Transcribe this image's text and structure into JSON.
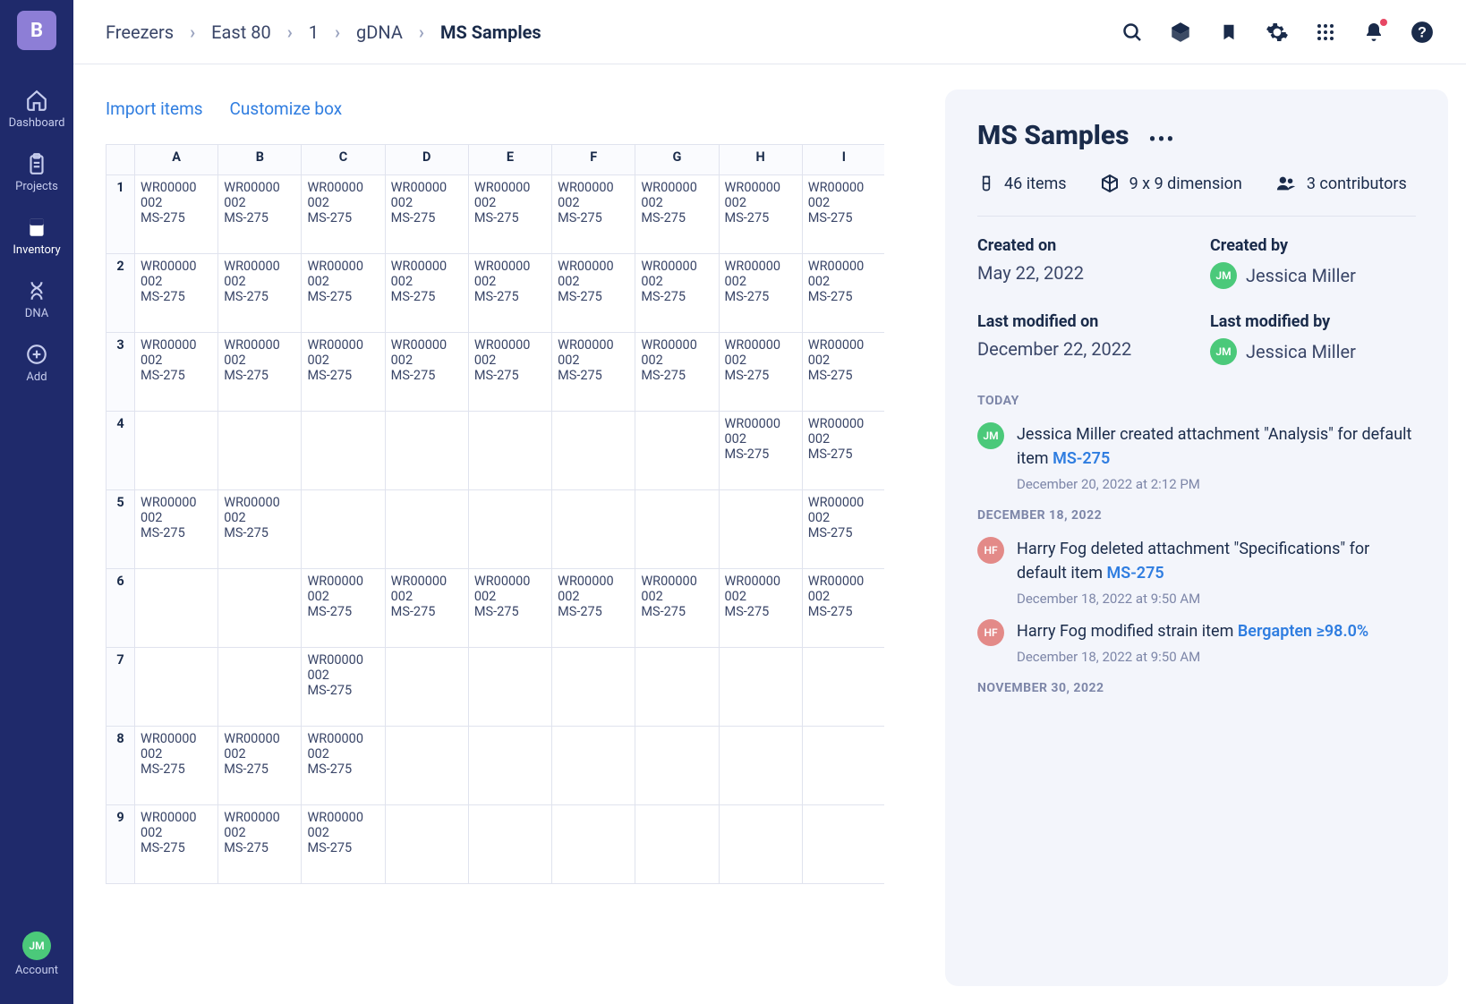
{
  "sidebar": {
    "logo_letter": "B",
    "items": [
      {
        "label": "Dashboard"
      },
      {
        "label": "Projects"
      },
      {
        "label": "Inventory"
      },
      {
        "label": "DNA"
      },
      {
        "label": "Add"
      }
    ],
    "account_label": "Account",
    "account_initials": "JM"
  },
  "breadcrumb": [
    {
      "label": "Freezers"
    },
    {
      "label": "East 80"
    },
    {
      "label": "1"
    },
    {
      "label": "gDNA"
    },
    {
      "label": "MS Samples",
      "current": true
    }
  ],
  "toolbar": {
    "import_label": "Import items",
    "customize_label": "Customize box"
  },
  "grid": {
    "columns": [
      "A",
      "B",
      "C",
      "D",
      "E",
      "F",
      "G",
      "H",
      "I"
    ],
    "cell": {
      "l1": "WR00000",
      "l2": "002",
      "l3": "MS-275"
    },
    "rows": [
      {
        "n": "1",
        "fill": [
          1,
          1,
          1,
          1,
          1,
          1,
          1,
          1,
          1
        ]
      },
      {
        "n": "2",
        "fill": [
          1,
          1,
          1,
          1,
          1,
          1,
          1,
          1,
          1
        ]
      },
      {
        "n": "3",
        "fill": [
          1,
          1,
          1,
          1,
          1,
          1,
          1,
          1,
          1
        ]
      },
      {
        "n": "4",
        "fill": [
          0,
          0,
          0,
          0,
          0,
          0,
          0,
          1,
          1
        ]
      },
      {
        "n": "5",
        "fill": [
          1,
          1,
          0,
          0,
          0,
          0,
          0,
          0,
          1
        ]
      },
      {
        "n": "6",
        "fill": [
          0,
          0,
          1,
          1,
          1,
          1,
          1,
          1,
          1
        ]
      },
      {
        "n": "7",
        "fill": [
          0,
          0,
          1,
          0,
          0,
          0,
          0,
          0,
          0
        ]
      },
      {
        "n": "8",
        "fill": [
          1,
          1,
          1,
          0,
          0,
          0,
          0,
          0,
          0
        ]
      },
      {
        "n": "9",
        "fill": [
          1,
          1,
          1,
          0,
          0,
          0,
          0,
          0,
          0
        ]
      }
    ]
  },
  "panel": {
    "title": "MS Samples",
    "stats": {
      "items_count": "46 items",
      "dimension": "9 x 9 dimension",
      "contributors": "3 contributors"
    },
    "meta": {
      "created_on_label": "Created on",
      "created_on": "May 22, 2022",
      "created_by_label": "Created by",
      "created_by": "Jessica Miller",
      "created_by_initials": "JM",
      "modified_on_label": "Last modified on",
      "modified_on": "December 22, 2022",
      "modified_by_label": "Last modified by",
      "modified_by": "Jessica Miller",
      "modified_by_initials": "JM"
    },
    "activity": {
      "today_label": "TODAY",
      "dec18_label": "DECEMBER 18, 2022",
      "nov30_label": "NOVEMBER 30, 2022",
      "items": [
        {
          "initials": "JM",
          "avatar": "jm",
          "text_before": "Jessica Miller created attachment \"Analysis\" for default item ",
          "link": "MS-275",
          "timestamp": "December 20, 2022 at 2:12 PM"
        },
        {
          "initials": "HF",
          "avatar": "hf",
          "text_before": "Harry Fog deleted attachment \"Specifications\" for default item ",
          "link": "MS-275",
          "timestamp": "December 18, 2022 at 9:50 AM"
        },
        {
          "initials": "HF",
          "avatar": "hf",
          "text_before": "Harry Fog modified strain item ",
          "link": "Bergapten ≥98.0%",
          "timestamp": "December 18, 2022 at 9:50 AM"
        }
      ]
    }
  }
}
